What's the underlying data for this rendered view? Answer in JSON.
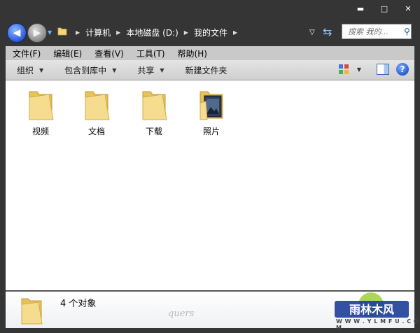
{
  "window": {
    "caption": {
      "minimize": "▬",
      "maximize": "□",
      "close": "✕"
    }
  },
  "address": {
    "crumbs": [
      "计算机",
      "本地磁盘 (D:)",
      "我的文件"
    ],
    "search_placeholder": "搜索 我的..."
  },
  "menu": [
    "文件(F)",
    "编辑(E)",
    "查看(V)",
    "工具(T)",
    "帮助(H)"
  ],
  "commands": {
    "organize": "组织",
    "include_in_library": "包含到库中",
    "share": "共享",
    "new_folder": "新建文件夹"
  },
  "folders": [
    {
      "name": "视频",
      "icon": "folder-icon"
    },
    {
      "name": "文档",
      "icon": "folder-icon"
    },
    {
      "name": "下载",
      "icon": "folder-icon"
    },
    {
      "name": "照片",
      "icon": "folder-photos-icon"
    }
  ],
  "details": {
    "count_text": "4 个对象"
  },
  "watermark": {
    "signature": "quers",
    "logo_text": "雨林木风",
    "url": "W W W . Y L M F U . C O M"
  },
  "colors": {
    "frame": "#353535",
    "menubar": "#c9c9c9",
    "folder": "#f2d47a"
  }
}
